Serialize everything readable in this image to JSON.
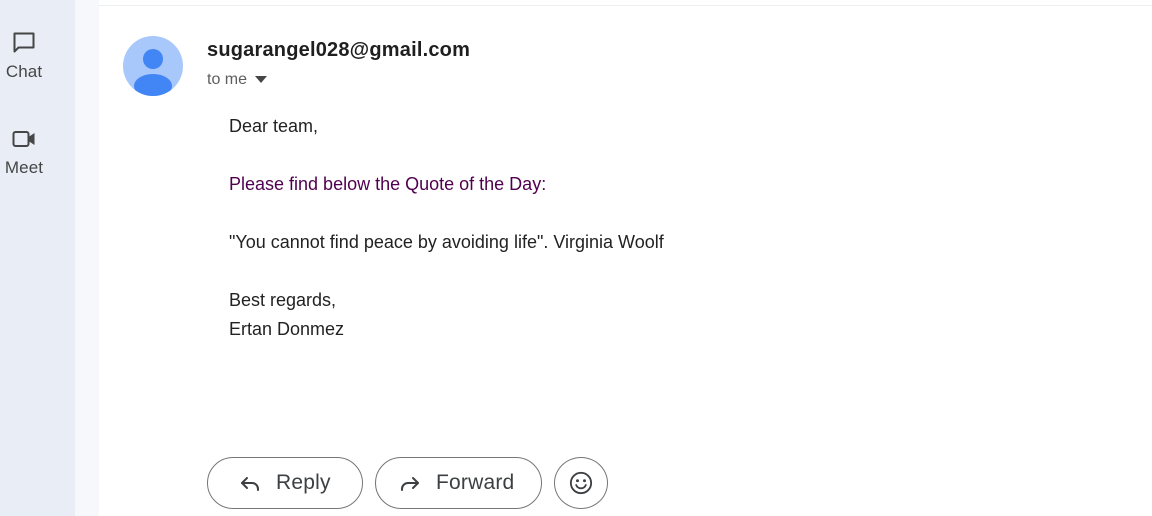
{
  "nav_rail": {
    "items": [
      {
        "label": "Chat",
        "icon": "chat-icon"
      },
      {
        "label": "Meet",
        "icon": "video-camera-icon"
      }
    ]
  },
  "email": {
    "sender": "sugarangel028@gmail.com",
    "recipients_label": "to me",
    "body": {
      "greeting": "Dear team,",
      "intro": "Please find below the Quote of the Day:",
      "quote": "\"You cannot find peace by avoiding life\". Virginia Woolf",
      "signoff": "Best regards,",
      "signature": "Ertan Donmez"
    },
    "colors": {
      "avatar_bg": "#a8c7fa",
      "avatar_figure": "#4285f4",
      "intro_text": "#500050"
    }
  },
  "actions": {
    "reply_label": "Reply",
    "forward_label": "Forward",
    "emoji_icon": "smiley-icon"
  }
}
